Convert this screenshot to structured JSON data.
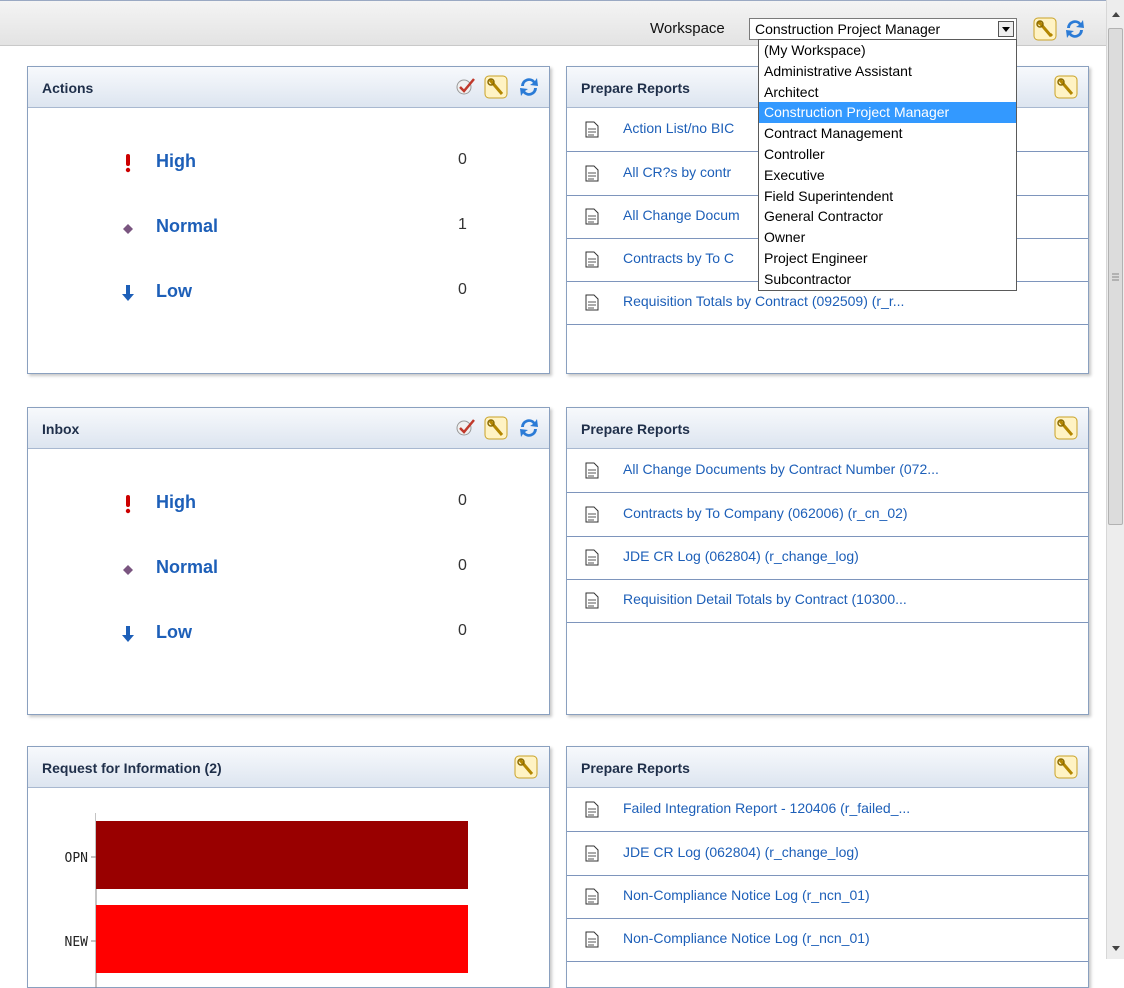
{
  "header": {
    "workspace_label": "Workspace",
    "workspace_selected": "Construction Project Manager",
    "icons": [
      "settings-wrench-icon",
      "refresh-icon"
    ]
  },
  "workspace_dropdown": {
    "options": [
      "(My Workspace)",
      "Administrative Assistant",
      "Architect",
      "Construction Project Manager",
      "Contract Management",
      "Controller",
      "Executive",
      "Field Superintendent",
      "General Contractor",
      "Owner",
      "Project Engineer",
      "Subcontractor"
    ],
    "selected_index": 3,
    "highlight_color": "#3399ff"
  },
  "actions": {
    "title": "Actions",
    "icons": [
      "check-icon",
      "settings-wrench-icon",
      "refresh-icon"
    ],
    "rows": [
      {
        "label": "High",
        "count": "0",
        "icon": "exclamation-icon",
        "color": "#cc0000"
      },
      {
        "label": "Normal",
        "count": "1",
        "icon": "diamond-icon",
        "color": "#7a5580"
      },
      {
        "label": "Low",
        "count": "0",
        "icon": "down-arrow-icon",
        "color": "#1d5fb8"
      }
    ]
  },
  "inbox": {
    "title": "Inbox",
    "icons": [
      "check-icon",
      "settings-wrench-icon",
      "refresh-icon"
    ],
    "rows": [
      {
        "label": "High",
        "count": "0",
        "icon": "exclamation-icon",
        "color": "#cc0000"
      },
      {
        "label": "Normal",
        "count": "0",
        "icon": "diamond-icon",
        "color": "#7a5580"
      },
      {
        "label": "Low",
        "count": "0",
        "icon": "down-arrow-icon",
        "color": "#1d5fb8"
      }
    ]
  },
  "reports1": {
    "title": "Prepare Reports",
    "items": [
      "Action List/no BIC",
      "All CR?s by contr",
      "All Change Docum",
      "Contracts by To C",
      "Requisition Totals by Contract (092509) (r_r..."
    ]
  },
  "reports2": {
    "title": "Prepare Reports",
    "items": [
      "All Change Documents by Contract Number (072...",
      "Contracts by To Company (062006) (r_cn_02)",
      "JDE CR Log (062804) (r_change_log)",
      "Requisition Detail Totals by Contract (10300..."
    ]
  },
  "reports3": {
    "title": "Prepare Reports",
    "items": [
      "Failed Integration Report - 120406 (r_failed_...",
      "JDE CR Log (062804) (r_change_log)",
      "Non-Compliance Notice Log (r_ncn_01)",
      "Non-Compliance Notice Log (r_ncn_01)"
    ]
  },
  "rfi": {
    "title": "Request for Information (2)"
  },
  "chart_data": {
    "type": "bar",
    "orientation": "horizontal",
    "categories": [
      "OPN",
      "NEW"
    ],
    "values": [
      1,
      1
    ],
    "colors": [
      "#990000",
      "#ff0000"
    ]
  }
}
